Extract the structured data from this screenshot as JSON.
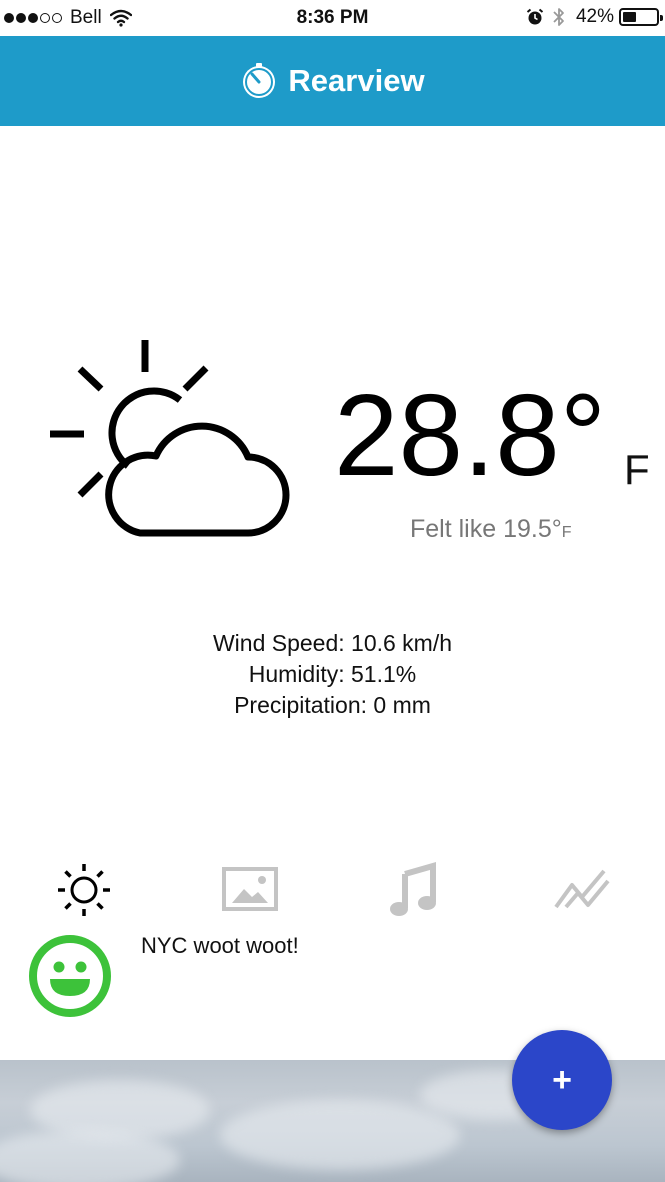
{
  "status_bar": {
    "carrier": "Bell",
    "time": "8:36 PM",
    "battery_percent_label": "42%",
    "battery_level": 0.42,
    "signal_bars_filled": 3,
    "signal_bars_total": 5
  },
  "header": {
    "title": "Rearview",
    "background_color": "#1e9bc9",
    "logo_icon": "stopwatch-icon"
  },
  "weather": {
    "icon": "partly-cloudy-icon",
    "temperature": "28.8°",
    "temperature_unit": "F",
    "felt_like_label": "Felt like 19.5°",
    "felt_like_unit": "F",
    "details": [
      "Wind Speed: 10.6 km/h",
      "Humidity: 51.1%",
      "Precipitation: 0 mm"
    ]
  },
  "tabs": [
    {
      "icon": "sun-icon",
      "active": true
    },
    {
      "icon": "image-icon",
      "active": false
    },
    {
      "icon": "music-note-icon",
      "active": false
    },
    {
      "icon": "trend-chart-icon",
      "active": false
    }
  ],
  "post": {
    "mood_icon": "smiley-icon",
    "mood_color": "#3dc23a",
    "text": "NYC woot woot!"
  },
  "fab": {
    "label": "+",
    "color": "#2b46c9"
  }
}
